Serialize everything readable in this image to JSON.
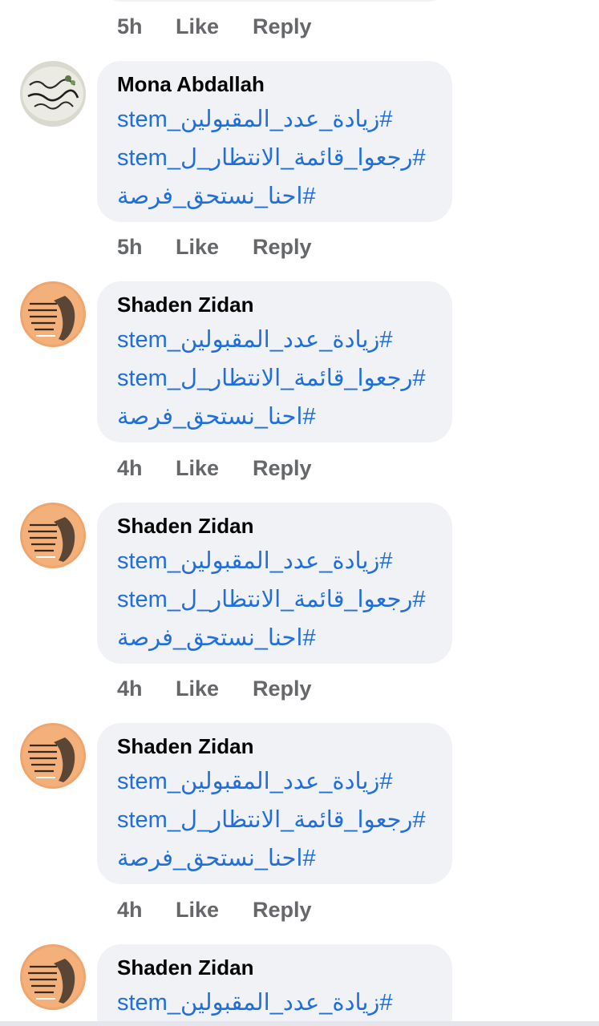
{
  "actions": {
    "like_label": "Like",
    "reply_label": "Reply"
  },
  "top_actions": {
    "time": "5h"
  },
  "comments": [
    {
      "author": "Mona Abdallah",
      "avatar": "calligraphy-avatar",
      "lines": [
        "#زيادة_عدد_المقبولين_stem",
        "#رجعوا_قائمة_الانتظار_ل_stem",
        "#احنا_نستحق_فرصة"
      ],
      "time": "5h"
    },
    {
      "author": "Shaden Zidan",
      "avatar": "orange-portrait-avatar",
      "lines": [
        "#زيادة_عدد_المقبولين_stem",
        "#رجعوا_قائمة_الانتظار_ل_stem",
        "#احنا_نستحق_فرصة"
      ],
      "time": "4h"
    },
    {
      "author": "Shaden Zidan",
      "avatar": "orange-portrait-avatar",
      "lines": [
        "#زيادة_عدد_المقبولين_stem",
        "#رجعوا_قائمة_الانتظار_ل_stem",
        "#احنا_نستحق_فرصة"
      ],
      "time": "4h"
    },
    {
      "author": "Shaden Zidan",
      "avatar": "orange-portrait-avatar",
      "lines": [
        "#زيادة_عدد_المقبولين_stem",
        "#رجعوا_قائمة_الانتظار_ل_stem",
        "#احنا_نستحق_فرصة"
      ],
      "time": "4h"
    },
    {
      "author": "Shaden Zidan",
      "avatar": "orange-portrait-avatar",
      "lines": [
        "#زيادة_عدد_المقبولين_stem"
      ]
    }
  ],
  "colors": {
    "bubble": "#f0f2f5",
    "hashtag": "#216fdb",
    "meta": "#65676b",
    "author": "#050505"
  }
}
